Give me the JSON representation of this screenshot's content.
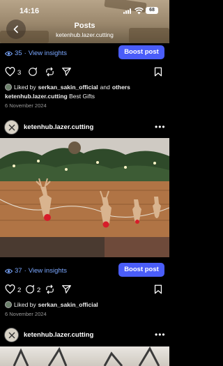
{
  "status_bar": {
    "time": "14:16",
    "battery": "68"
  },
  "header": {
    "title": "Posts",
    "subtitle": "ketenhub.lazer.cutting"
  },
  "posts": [
    {
      "views": "35",
      "insights_label": "View insights",
      "boost_label": "Boost post",
      "like_count": "3",
      "comment_count": "2",
      "liked_prefix": "Liked by",
      "liked_user": "serkan_sakin_official",
      "liked_suffix": "and",
      "liked_others": "others",
      "caption_user": "ketenhub.lazer.cutting",
      "caption_text": "Best Gifts",
      "date": "6 November 2024"
    },
    {
      "account": "ketenhub.lazer.cutting",
      "views": "37",
      "insights_label": "View insights",
      "boost_label": "Boost post",
      "like_count": "2",
      "comment_count": "2",
      "liked_prefix": "Liked by",
      "liked_user": "serkan_sakin_official",
      "date": "6 November 2024"
    }
  ],
  "next_post": {
    "account": "ketenhub.lazer.cutting"
  },
  "more_glyph": "•••",
  "colors": {
    "accent": "#4a5df9",
    "insights": "#7aa7ff",
    "background": "#000000"
  },
  "icons": [
    "back-arrow-icon",
    "eye-icon",
    "heart-icon",
    "comment-icon",
    "repost-icon",
    "send-icon",
    "bookmark-icon",
    "more-icon"
  ]
}
